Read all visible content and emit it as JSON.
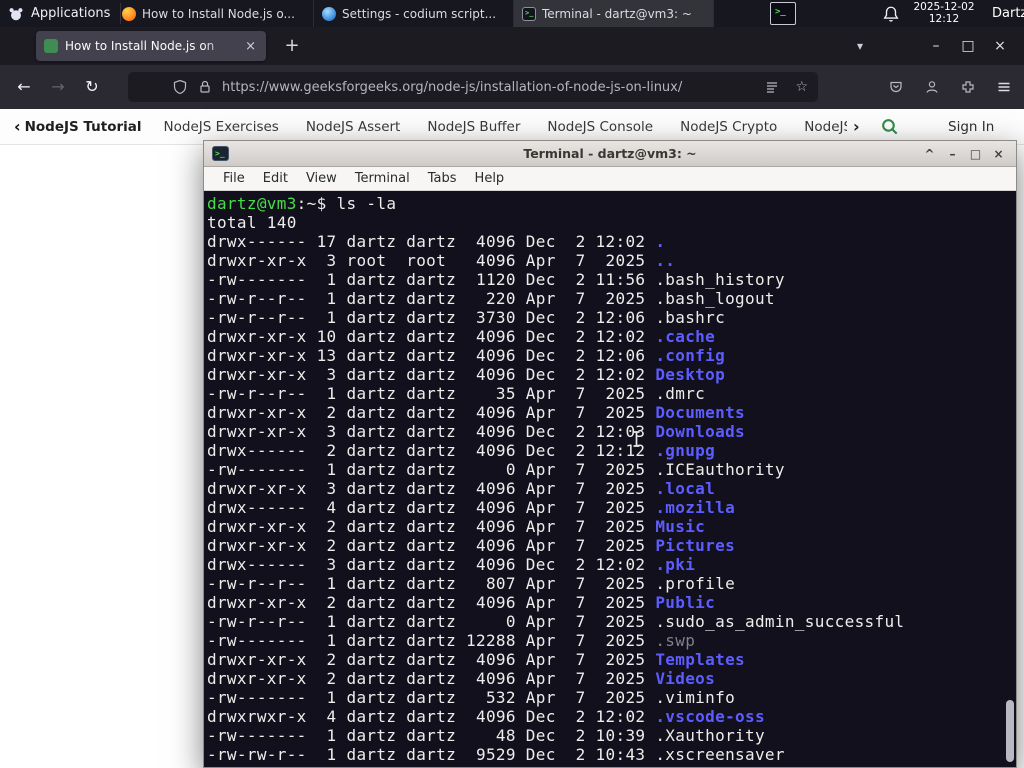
{
  "panel": {
    "applications_label": "Applications",
    "tasks": [
      {
        "label": "How to Install Node.js o...",
        "icon": "firefox",
        "active": false
      },
      {
        "label": "Settings - codium script...",
        "icon": "settings",
        "active": false
      },
      {
        "label": "Terminal - dartz@vm3: ~",
        "icon": "terminal",
        "active": true
      }
    ],
    "clock_date": "2025-12-02",
    "clock_time": "12:12",
    "user": "Dartz"
  },
  "browser": {
    "tab_title": "How to Install Node.js on",
    "url": "https://www.geeksforgeeks.org/node-js/installation-of-node-js-on-linux/",
    "site_nav": {
      "primary": "NodeJS Tutorial",
      "items": [
        "NodeJS Exercises",
        "NodeJS Assert",
        "NodeJS Buffer",
        "NodeJS Console",
        "NodeJS Crypto",
        "NodeJS DNS",
        "Node"
      ],
      "signin": "Sign In"
    }
  },
  "terminal": {
    "title": "Terminal - dartz@vm3: ~",
    "menu": [
      "File",
      "Edit",
      "View",
      "Terminal",
      "Tabs",
      "Help"
    ],
    "lines": [
      [
        {
          "c": "u",
          "t": "dartz@vm3"
        },
        {
          "c": "p",
          "t": ":~$ ls -la"
        }
      ],
      [
        {
          "c": "p",
          "t": "total 140"
        }
      ],
      [
        {
          "c": "p",
          "t": "drwx------ 17 dartz dartz  4096 Dec  2 12:02 "
        },
        {
          "c": "d",
          "t": "."
        }
      ],
      [
        {
          "c": "p",
          "t": "drwxr-xr-x  3 root  root   4096 Apr  7  2025 "
        },
        {
          "c": "d",
          "t": ".."
        }
      ],
      [
        {
          "c": "p",
          "t": "-rw-------  1 dartz dartz  1120 Dec  2 11:56 .bash_history"
        }
      ],
      [
        {
          "c": "p",
          "t": "-rw-r--r--  1 dartz dartz   220 Apr  7  2025 .bash_logout"
        }
      ],
      [
        {
          "c": "p",
          "t": "-rw-r--r--  1 dartz dartz  3730 Dec  2 12:06 .bashrc"
        }
      ],
      [
        {
          "c": "p",
          "t": "drwxr-xr-x 10 dartz dartz  4096 Dec  2 12:02 "
        },
        {
          "c": "d",
          "t": ".cache"
        }
      ],
      [
        {
          "c": "p",
          "t": "drwxr-xr-x 13 dartz dartz  4096 Dec  2 12:06 "
        },
        {
          "c": "d",
          "t": ".config"
        }
      ],
      [
        {
          "c": "p",
          "t": "drwxr-xr-x  3 dartz dartz  4096 Dec  2 12:02 "
        },
        {
          "c": "d",
          "t": "Desktop"
        }
      ],
      [
        {
          "c": "p",
          "t": "-rw-r--r--  1 dartz dartz    35 Apr  7  2025 .dmrc"
        }
      ],
      [
        {
          "c": "p",
          "t": "drwxr-xr-x  2 dartz dartz  4096 Apr  7  2025 "
        },
        {
          "c": "d",
          "t": "Documents"
        }
      ],
      [
        {
          "c": "p",
          "t": "drwxr-xr-x  3 dartz dartz  4096 Dec  2 12:03 "
        },
        {
          "c": "d",
          "t": "Downloads"
        }
      ],
      [
        {
          "c": "p",
          "t": "drwx------  2 dartz dartz  4096 Dec  2 12:12 "
        },
        {
          "c": "d",
          "t": ".gnupg"
        }
      ],
      [
        {
          "c": "p",
          "t": "-rw-------  1 dartz dartz     0 Apr  7  2025 .ICEauthority"
        }
      ],
      [
        {
          "c": "p",
          "t": "drwxr-xr-x  3 dartz dartz  4096 Apr  7  2025 "
        },
        {
          "c": "d",
          "t": ".local"
        }
      ],
      [
        {
          "c": "p",
          "t": "drwx------  4 dartz dartz  4096 Apr  7  2025 "
        },
        {
          "c": "d",
          "t": ".mozilla"
        }
      ],
      [
        {
          "c": "p",
          "t": "drwxr-xr-x  2 dartz dartz  4096 Apr  7  2025 "
        },
        {
          "c": "d",
          "t": "Music"
        }
      ],
      [
        {
          "c": "p",
          "t": "drwxr-xr-x  2 dartz dartz  4096 Apr  7  2025 "
        },
        {
          "c": "d",
          "t": "Pictures"
        }
      ],
      [
        {
          "c": "p",
          "t": "drwx------  3 dartz dartz  4096 Dec  2 12:02 "
        },
        {
          "c": "d",
          "t": ".pki"
        }
      ],
      [
        {
          "c": "p",
          "t": "-rw-r--r--  1 dartz dartz   807 Apr  7  2025 .profile"
        }
      ],
      [
        {
          "c": "p",
          "t": "drwxr-xr-x  2 dartz dartz  4096 Apr  7  2025 "
        },
        {
          "c": "d",
          "t": "Public"
        }
      ],
      [
        {
          "c": "p",
          "t": "-rw-r--r--  1 dartz dartz     0 Apr  7  2025 .sudo_as_admin_successful"
        }
      ],
      [
        {
          "c": "p",
          "t": "-rw-------  1 dartz dartz 12288 Apr  7  2025 "
        },
        {
          "c": "m",
          "t": ".swp"
        }
      ],
      [
        {
          "c": "p",
          "t": "drwxr-xr-x  2 dartz dartz  4096 Apr  7  2025 "
        },
        {
          "c": "d",
          "t": "Templates"
        }
      ],
      [
        {
          "c": "p",
          "t": "drwxr-xr-x  2 dartz dartz  4096 Apr  7  2025 "
        },
        {
          "c": "d",
          "t": "Videos"
        }
      ],
      [
        {
          "c": "p",
          "t": "-rw-------  1 dartz dartz   532 Apr  7  2025 .viminfo"
        }
      ],
      [
        {
          "c": "p",
          "t": "drwxrwxr-x  4 dartz dartz  4096 Dec  2 12:02 "
        },
        {
          "c": "d",
          "t": ".vscode-oss"
        }
      ],
      [
        {
          "c": "p",
          "t": "-rw-------  1 dartz dartz    48 Dec  2 10:39 .Xauthority"
        }
      ],
      [
        {
          "c": "p",
          "t": "-rw-rw-r--  1 dartz dartz  9529 Dec  2 10:43 .xscreensaver"
        }
      ]
    ]
  },
  "icons": {
    "close": "×",
    "minimize": "–",
    "maximize": "□",
    "shade": "^",
    "new_tab": "+",
    "tab_list": "▾",
    "back": "←",
    "forward": "→",
    "reload": "↻",
    "star": "☆",
    "chevron_left": "‹",
    "chevron_right": "›"
  },
  "colors": {
    "accent_green": "#2f8d46",
    "dir_blue": "#5d5dff",
    "prompt_green": "#47dd47",
    "terminal_bg": "#11101c"
  }
}
